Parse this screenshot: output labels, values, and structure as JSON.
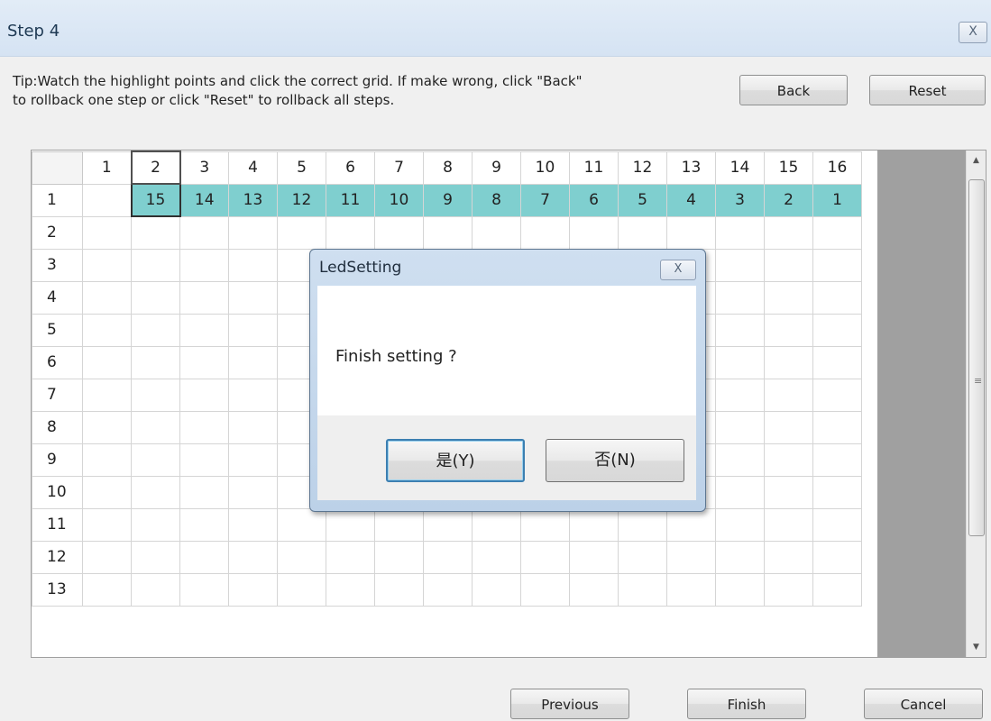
{
  "window": {
    "title": "Step 4",
    "close_glyph": "X"
  },
  "tip": {
    "line1": "Tip:Watch the highlight points and click the correct grid. If make wrong, click \"Back\"",
    "line2": "to rollback one step or click \"Reset\" to rollback all steps."
  },
  "toolbar": {
    "back_label": "Back",
    "reset_label": "Reset"
  },
  "grid": {
    "columns": [
      "1",
      "2",
      "3",
      "4",
      "5",
      "6",
      "7",
      "8",
      "9",
      "10",
      "11",
      "12",
      "13",
      "14",
      "15",
      "16"
    ],
    "rows": [
      "1",
      "2",
      "3",
      "4",
      "5",
      "6",
      "7",
      "8",
      "9",
      "10",
      "11",
      "12",
      "13"
    ],
    "row1_values": [
      "",
      "15",
      "14",
      "13",
      "12",
      "11",
      "10",
      "9",
      "8",
      "7",
      "6",
      "5",
      "4",
      "3",
      "2",
      "1"
    ],
    "highlight_color": "#7fcfcf",
    "selected_column": "2"
  },
  "dialog": {
    "title": "LedSetting",
    "close_glyph": "X",
    "message": "Finish setting ?",
    "yes_label": "是(Y)",
    "no_label": "否(N)"
  },
  "footer": {
    "previous_label": "Previous",
    "finish_label": "Finish",
    "cancel_label": "Cancel"
  }
}
